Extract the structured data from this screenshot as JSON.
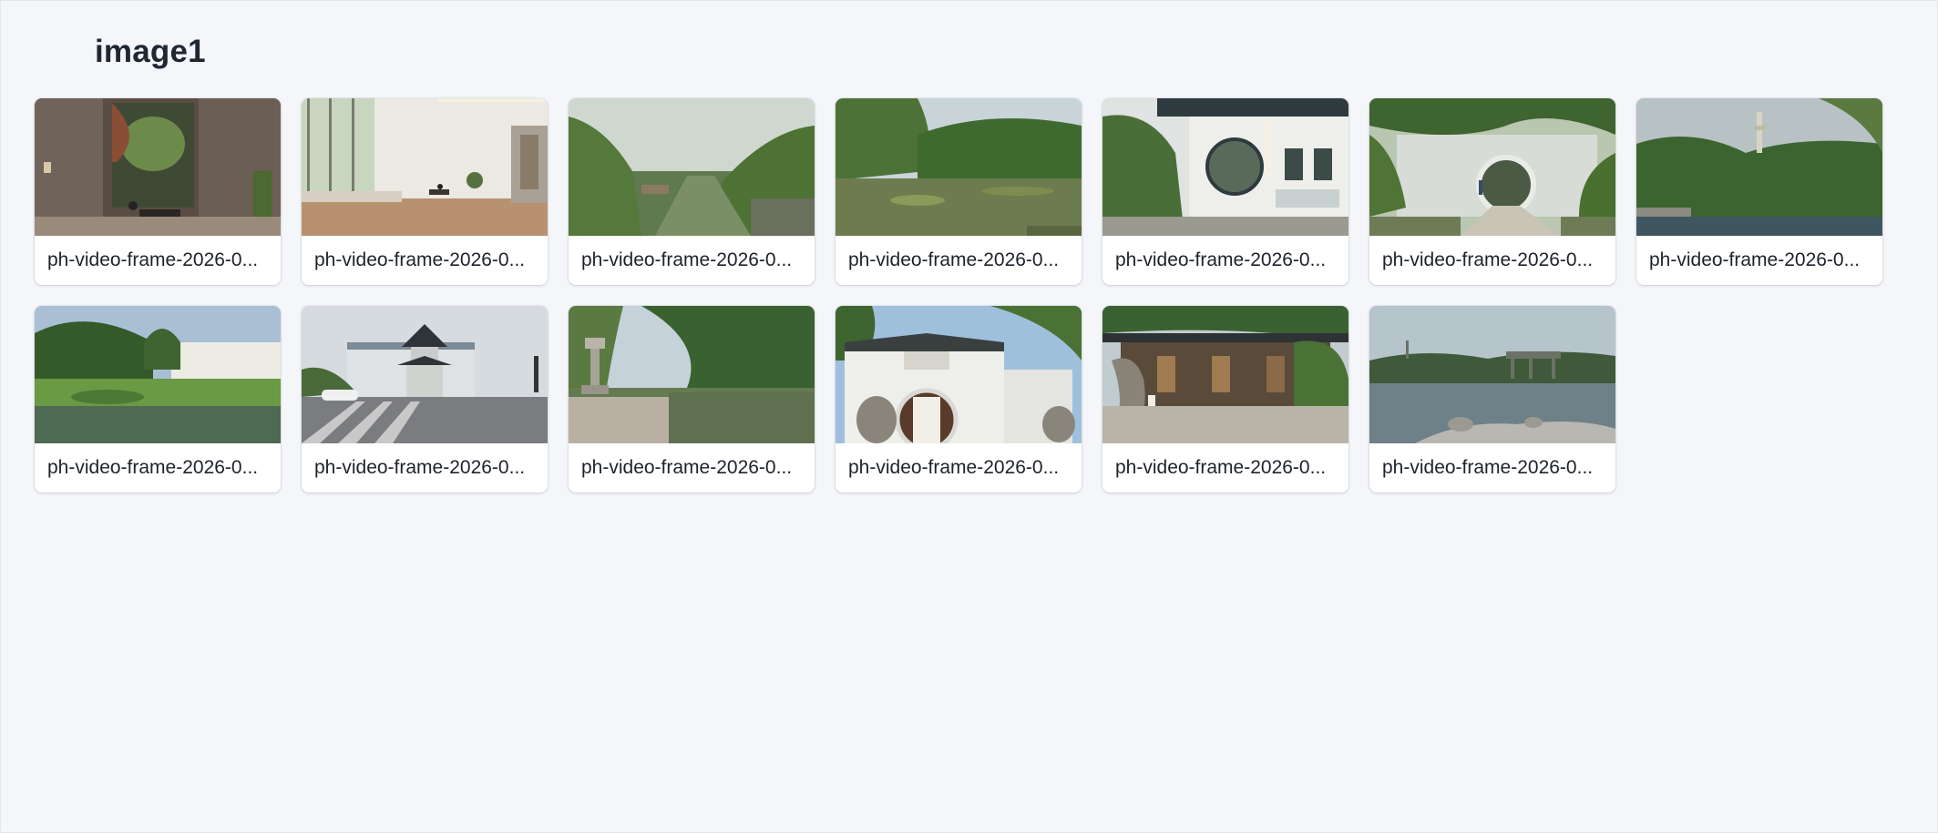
{
  "page": {
    "title": "image1"
  },
  "images": [
    {
      "name": "ph-video-frame-2026-0...",
      "scene": "atrium-interior"
    },
    {
      "name": "ph-video-frame-2026-0...",
      "scene": "minimal-room"
    },
    {
      "name": "ph-video-frame-2026-0...",
      "scene": "canal-willows"
    },
    {
      "name": "ph-video-frame-2026-0...",
      "scene": "lotus-pond"
    },
    {
      "name": "ph-video-frame-2026-0...",
      "scene": "moon-gate-building"
    },
    {
      "name": "ph-video-frame-2026-0...",
      "scene": "garden-moon-gate-path"
    },
    {
      "name": "ph-video-frame-2026-0...",
      "scene": "lake-pagoda"
    },
    {
      "name": "ph-video-frame-2026-0...",
      "scene": "garden-wall-reflection"
    },
    {
      "name": "ph-video-frame-2026-0...",
      "scene": "street-pagoda"
    },
    {
      "name": "ph-video-frame-2026-0...",
      "scene": "waterside-lantern"
    },
    {
      "name": "ph-video-frame-2026-0...",
      "scene": "white-gate-lions"
    },
    {
      "name": "ph-video-frame-2026-0...",
      "scene": "pavilion-tree"
    },
    {
      "name": "ph-video-frame-2026-0...",
      "scene": "lake-bridge"
    }
  ],
  "colors": {
    "background": "#f4f6f9",
    "card": "#ffffff",
    "title": "#1f2733",
    "caption": "#1e232b"
  }
}
